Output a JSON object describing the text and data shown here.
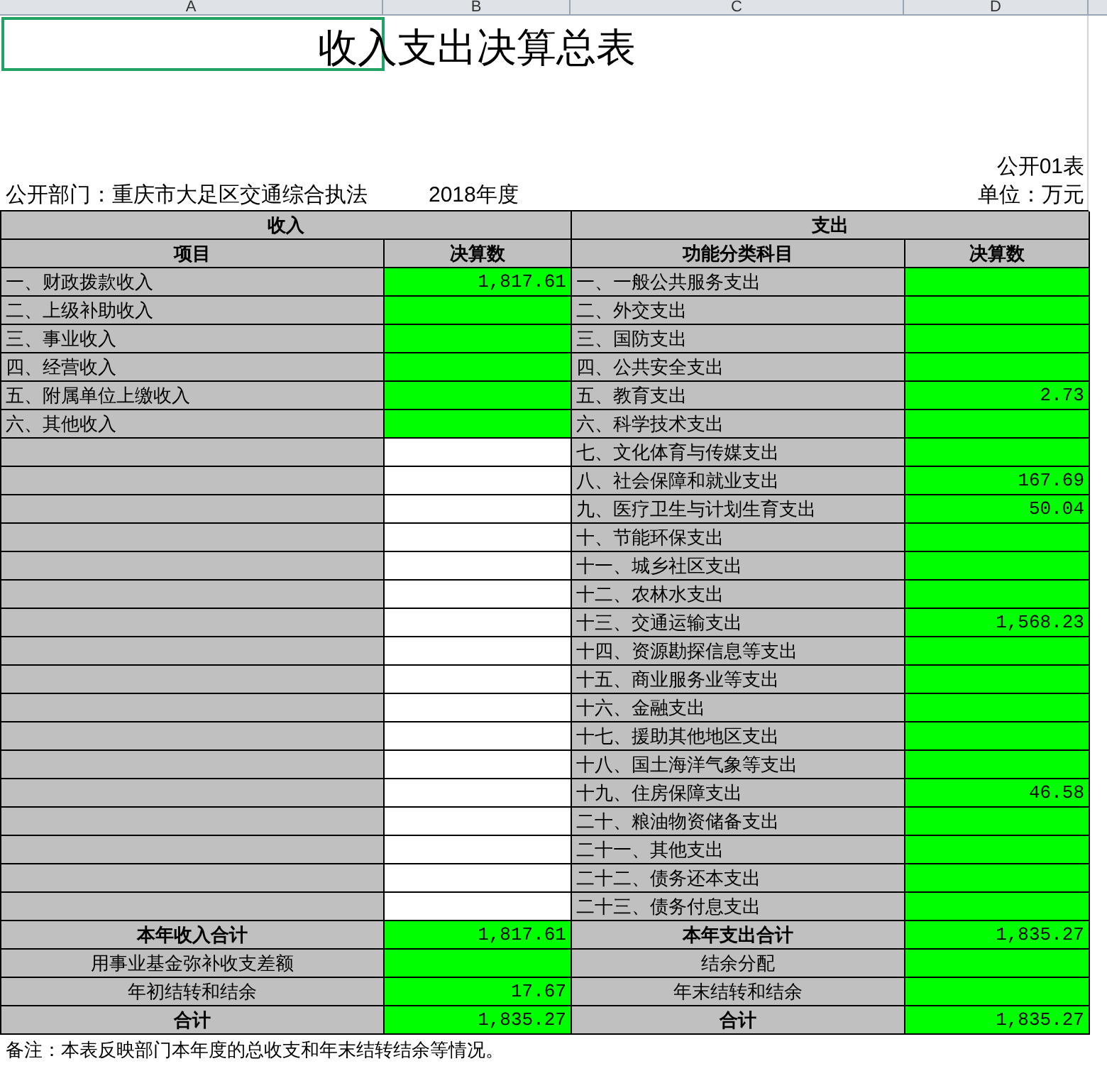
{
  "column_headers": [
    "A",
    "B",
    "C",
    "D"
  ],
  "title": "收入支出决算总表",
  "title_cell_selected": true,
  "form_no": "公开01表",
  "department": "公开部门：重庆市大足区交通综合执法",
  "year": "2018年度",
  "unit": "单位：万元",
  "section_headers": [
    "收入",
    "支出"
  ],
  "table_columns": [
    "项目",
    "决算数",
    "功能分类科目",
    "决算数"
  ],
  "income_rows": [
    {
      "label": "一、财政拨款收入",
      "value": "1,817.61"
    },
    {
      "label": "二、上级补助收入",
      "value": ""
    },
    {
      "label": "三、事业收入",
      "value": ""
    },
    {
      "label": "四、经营收入",
      "value": ""
    },
    {
      "label": "五、附属单位上缴收入",
      "value": ""
    },
    {
      "label": "六、其他收入",
      "value": ""
    }
  ],
  "expense_rows": [
    {
      "label": "一、一般公共服务支出",
      "value": ""
    },
    {
      "label": "二、外交支出",
      "value": ""
    },
    {
      "label": "三、国防支出",
      "value": ""
    },
    {
      "label": "四、公共安全支出",
      "value": ""
    },
    {
      "label": "五、教育支出",
      "value": "2.73"
    },
    {
      "label": "六、科学技术支出",
      "value": ""
    },
    {
      "label": "七、文化体育与传媒支出",
      "value": ""
    },
    {
      "label": "八、社会保障和就业支出",
      "value": "167.69"
    },
    {
      "label": "九、医疗卫生与计划生育支出",
      "value": "50.04"
    },
    {
      "label": "十、节能环保支出",
      "value": ""
    },
    {
      "label": "十一、城乡社区支出",
      "value": ""
    },
    {
      "label": "十二、农林水支出",
      "value": ""
    },
    {
      "label": "十三、交通运输支出",
      "value": "1,568.23"
    },
    {
      "label": "十四、资源勘探信息等支出",
      "value": ""
    },
    {
      "label": "十五、商业服务业等支出",
      "value": ""
    },
    {
      "label": "十六、金融支出",
      "value": ""
    },
    {
      "label": "十七、援助其他地区支出",
      "value": ""
    },
    {
      "label": "十八、国土海洋气象等支出",
      "value": ""
    },
    {
      "label": "十九、住房保障支出",
      "value": "46.58"
    },
    {
      "label": "二十、粮油物资储备支出",
      "value": ""
    },
    {
      "label": "二十一、其他支出",
      "value": ""
    },
    {
      "label": "二十二、债务还本支出",
      "value": ""
    },
    {
      "label": "二十三、债务付息支出",
      "value": ""
    }
  ],
  "summary_rows": [
    {
      "income_label": "本年收入合计",
      "income_value": "1,817.61",
      "expense_label": "本年支出合计",
      "expense_value": "1,835.27",
      "bold": true
    },
    {
      "income_label": "用事业基金弥补收支差额",
      "income_value": "",
      "expense_label": "结余分配",
      "expense_value": "",
      "bold": false
    },
    {
      "income_label": "年初结转和结余",
      "income_value": "17.67",
      "expense_label": "年末结转和结余",
      "expense_value": "",
      "bold": false
    },
    {
      "income_label": "合计",
      "income_value": "1,835.27",
      "expense_label": "合计",
      "expense_value": "1,835.27",
      "bold": true
    }
  ],
  "note": "备注：本表反映部门本年度的总收支和年末结转结余等情况。"
}
